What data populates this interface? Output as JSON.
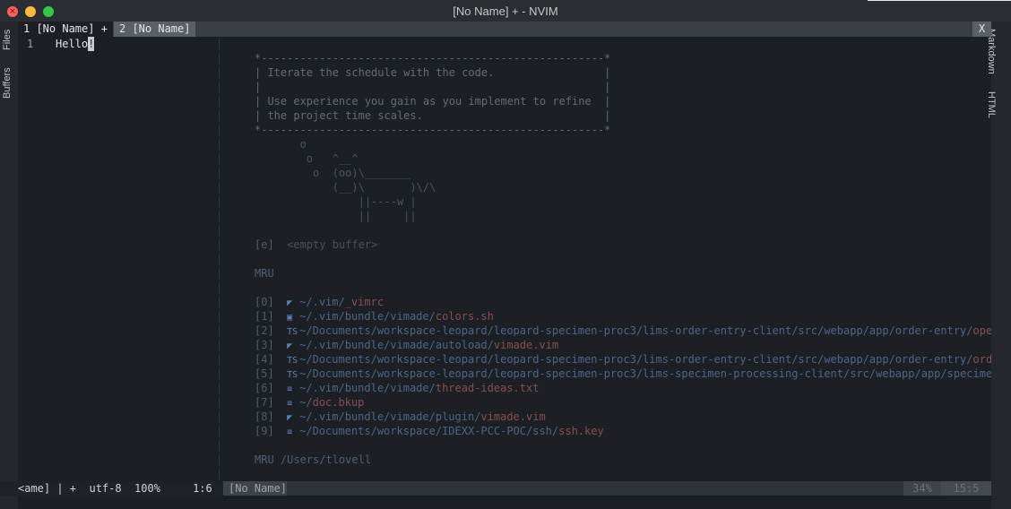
{
  "window": {
    "title": "[No Name] + - NVIM"
  },
  "side_tabs": {
    "files": "Files",
    "buffers": "Buffers",
    "markdown": "Markdown",
    "html": "HTML"
  },
  "tabline": {
    "tab1": "1 [No Name] +",
    "tab2": "2 [No Name]",
    "close": "X"
  },
  "editor": {
    "line_number": "1",
    "text_before_cursor": "Hello",
    "cursor_char": "!"
  },
  "startify": {
    "header_lines": [
      "*-----------------------------------------------------*",
      "| Iterate the schedule with the code.                 |",
      "|                                                     |",
      "| Use experience you gain as you implement to refine  |",
      "| the project time scales.                            |",
      "*-----------------------------------------------------*"
    ],
    "cow_lines": [
      "       o",
      "        o   ^__^",
      "         o  (oo)\\_______",
      "            (__)\\       )\\/\\",
      "                ||----w |",
      "                ||     ||"
    ],
    "empty_buffer": {
      "key": "[e]",
      "label": "<empty buffer>"
    },
    "mru_label": "MRU",
    "mru_items": [
      {
        "key": "[0]",
        "icon": "vim-icon",
        "glyph": "◤",
        "path": "~/.vim/",
        "name": "_vimrc"
      },
      {
        "key": "[1]",
        "icon": "shell-icon",
        "glyph": "▣",
        "path": "~/.vim/bundle/vimade/",
        "name": "colors.sh"
      },
      {
        "key": "[2]",
        "icon": "typescript-icon",
        "glyph": "TS",
        "path": "~/Documents/workspace-leopard/leopard-specimen-proc3/lims-order-entry-client/src/webapp/app/order-entry/",
        "name": "oper"
      },
      {
        "key": "[3]",
        "icon": "vim-icon",
        "glyph": "◤",
        "path": "~/.vim/bundle/vimade/autoload/",
        "name": "vimade.vim"
      },
      {
        "key": "[4]",
        "icon": "typescript-icon",
        "glyph": "TS",
        "path": "~/Documents/workspace-leopard/leopard-specimen-proc3/lims-order-entry-client/src/webapp/app/order-entry/",
        "name": "orde"
      },
      {
        "key": "[5]",
        "icon": "typescript-icon",
        "glyph": "TS",
        "path": "~/Documents/workspace-leopard/leopard-specimen-proc3/lims-specimen-processing-client/src/webapp/app/specimen",
        "name": ""
      },
      {
        "key": "[6]",
        "icon": "text-file-icon",
        "glyph": "≡",
        "path": "~/.vim/bundle/vimade/",
        "name": "thread-ideas.txt"
      },
      {
        "key": "[7]",
        "icon": "text-file-icon",
        "glyph": "≡",
        "path": "~/",
        "name": "doc.bkup"
      },
      {
        "key": "[8]",
        "icon": "vim-icon",
        "glyph": "◤",
        "path": "~/.vim/bundle/vimade/plugin/",
        "name": "vimade.vim"
      },
      {
        "key": "[9]",
        "icon": "text-file-icon",
        "glyph": "≡",
        "path": "~/Documents/workspace/IDEXX-PCC-POC/ssh/",
        "name": "ssh.key"
      }
    ],
    "mru_cwd_label": "MRU /Users/tlovell"
  },
  "statusline": {
    "left": "<ame] | +  utf-8  100%     1:6",
    "buffer": "[No Name]",
    "percent": "34%",
    "position": "15:5"
  },
  "colors": {
    "background": "#1c2025",
    "path": "#4d6588",
    "filename": "#8a4d52",
    "icon": "#5e83b5"
  }
}
